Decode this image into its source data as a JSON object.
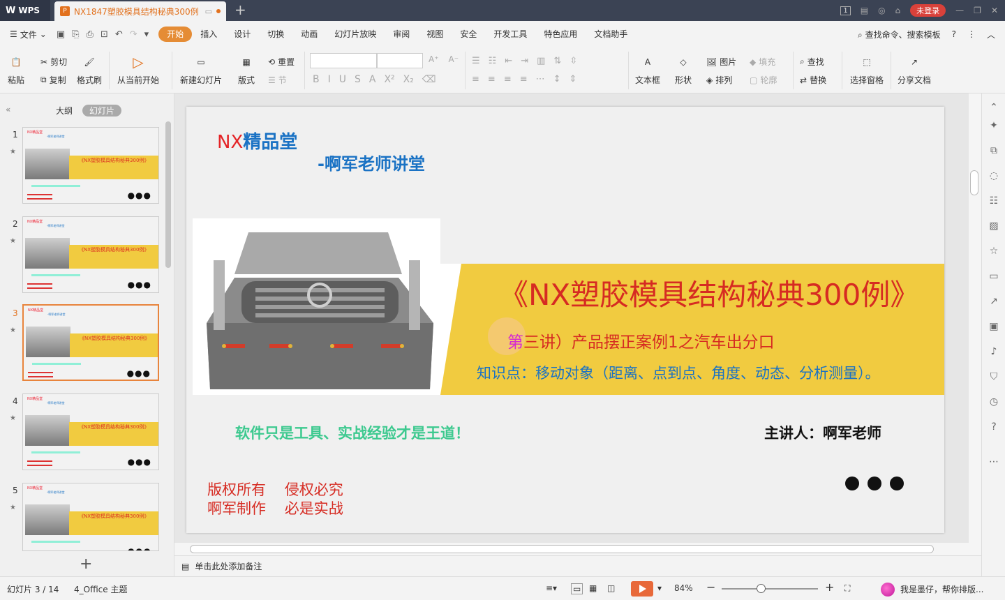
{
  "app": {
    "brand": "WPS",
    "brand_mark": "W"
  },
  "tab": {
    "title": "NX1847塑胶模具结构秘典300例",
    "file_icon": "P",
    "unsaved_dot": true
  },
  "titlebar": {
    "page_badge": "1",
    "login": "未登录"
  },
  "menu": {
    "file": "文件",
    "items": [
      "开始",
      "插入",
      "设计",
      "切换",
      "动画",
      "幻灯片放映",
      "审阅",
      "视图",
      "安全",
      "开发工具",
      "特色应用",
      "文档助手"
    ],
    "active": "开始",
    "search": "查找命令、搜索模板"
  },
  "toolbar": {
    "paste": "粘贴",
    "cut": "剪切",
    "copy": "复制",
    "format_painter": "格式刷",
    "from_current": "从当前开始",
    "new_slide": "新建幻灯片",
    "layout": "版式",
    "reset": "重置",
    "section": "节",
    "textbox": "文本框",
    "shape": "形状",
    "picture": "图片",
    "arrange": "排列",
    "fill": "填充",
    "outline": "轮廓",
    "find": "查找",
    "replace": "替换",
    "selection_pane": "选择窗格",
    "share": "分享文档"
  },
  "sidebar": {
    "tab_outline": "大纲",
    "tab_slides": "幻灯片",
    "thumbs": [
      {
        "num": "1",
        "title": "《NX塑胶模具结构秘典300例》"
      },
      {
        "num": "2",
        "title": "《NX塑胶模具结构秘典300例》"
      },
      {
        "num": "3",
        "title": "《NX塑胶模具结构秘典300例》"
      },
      {
        "num": "4",
        "title": "《NX塑胶模具结构秘典300例》"
      },
      {
        "num": "5",
        "title": "《NX塑胶模具结构秘典300例》"
      }
    ],
    "selected": "3",
    "thumb_logo": "NX精品堂",
    "thumb_sub": "-啊军老师讲堂"
  },
  "slide": {
    "logo_nx": "NX",
    "logo_rest": "精品堂",
    "subtitle": "-啊军老师讲堂",
    "title": "《NX塑胶模具结构秘典300例》",
    "lecture_pre": "第",
    "lecture": "三讲）产品摆正案例1之汽车出分口",
    "knowledge": "知识点：移动对象（距离、点到点、角度、动态、分析测量）。",
    "motto": "软件只是工具、实战经验才是王道！",
    "speaker": "主讲人：啊军老师",
    "copyright1": "版权所有    侵权必究",
    "copyright2": "啊军制作    必是实战"
  },
  "notes": {
    "placeholder": "单击此处添加备注"
  },
  "status": {
    "slide_counter": "幻灯片 3 / 14",
    "theme": "4_Office 主题",
    "zoom": "84%",
    "assistant": "我是墨仔，帮你排版..."
  }
}
